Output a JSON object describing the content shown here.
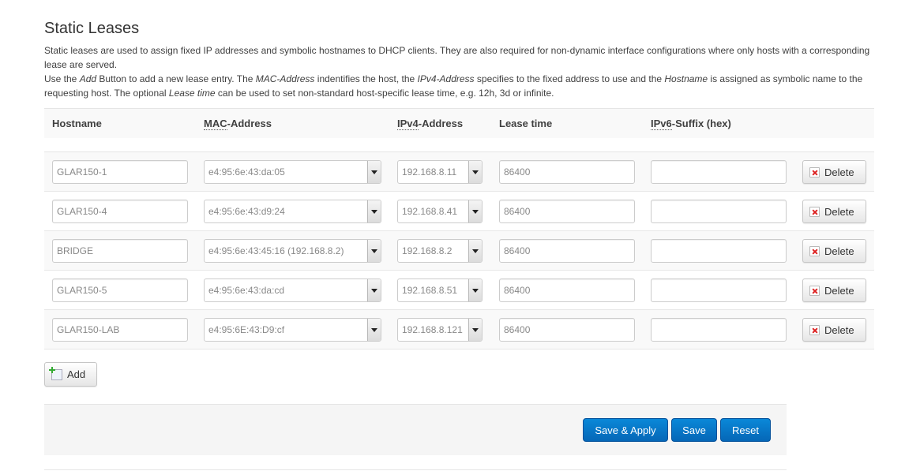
{
  "section": {
    "title": "Static Leases",
    "desc": {
      "p1": "Static leases are used to assign fixed IP addresses and symbolic hostnames to DHCP clients. They are also required for non-dynamic interface configurations where only hosts with a corresponding lease are served.",
      "p2a": "Use the ",
      "p2_add": "Add",
      "p2b": " Button to add a new lease entry. The ",
      "p2_mac": "MAC-Address",
      "p2c": " indentifies the host, the ",
      "p2_ipv4": "IPv4-Address",
      "p2d": " specifies to the fixed address to use and the ",
      "p2_host": "Hostname",
      "p2e": " is assigned as symbolic name to the requesting host. The optional ",
      "p2_lease": "Lease time",
      "p2f": " can be used to set non-standard host-specific lease time, e.g. 12h, 3d or infinite."
    }
  },
  "table": {
    "headers": {
      "hostname": "Hostname",
      "mac_abbr": "MAC",
      "mac_rest": "-Address",
      "ipv4_abbr": "IPv4",
      "ipv4_rest": "-Address",
      "lease": "Lease time",
      "ipv6_abbr": "IPv6",
      "ipv6_rest": "-Suffix (hex)"
    },
    "rows": [
      {
        "hostname": "GLAR150-1",
        "mac": "e4:95:6e:43:da:05",
        "ipv4": "192.168.8.11",
        "lease": "86400",
        "ipv6": "",
        "delete": "Delete"
      },
      {
        "hostname": "GLAR150-4",
        "mac": "e4:95:6e:43:d9:24",
        "ipv4": "192.168.8.41",
        "lease": "86400",
        "ipv6": "",
        "delete": "Delete"
      },
      {
        "hostname": "BRIDGE",
        "mac": "e4:95:6e:43:45:16 (192.168.8.2)",
        "ipv4": "192.168.8.2",
        "lease": "86400",
        "ipv6": "",
        "delete": "Delete"
      },
      {
        "hostname": "GLAR150-5",
        "mac": "e4:95:6e:43:da:cd",
        "ipv4": "192.168.8.51",
        "lease": "86400",
        "ipv6": "",
        "delete": "Delete"
      },
      {
        "hostname": "GLAR150-LAB",
        "mac": "e4:95:6E:43:D9:cf",
        "ipv4": "192.168.8.121",
        "lease": "86400",
        "ipv6": "",
        "delete": "Delete"
      }
    ]
  },
  "actions": {
    "add": "Add",
    "save_apply": "Save & Apply",
    "save": "Save",
    "reset": "Reset"
  },
  "icons": {
    "delete": "delete-x-icon",
    "add": "add-plus-icon",
    "dropdown": "chevron-down-icon"
  },
  "colors": {
    "primary": "#0567b7",
    "delete_icon": "#dd2222",
    "add_icon": "#33aa33"
  }
}
